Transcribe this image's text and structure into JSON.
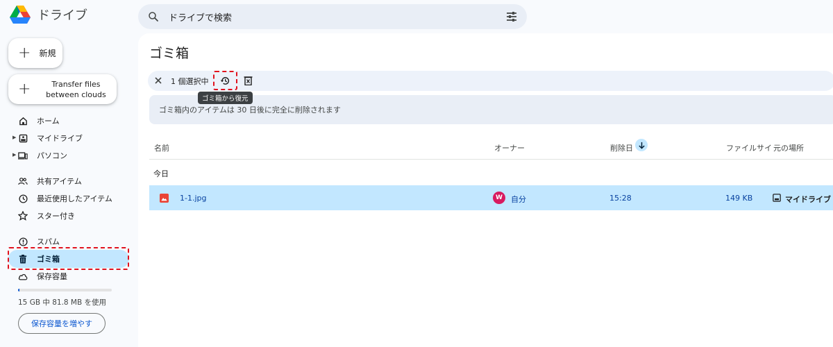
{
  "app": {
    "name": "ドライブ"
  },
  "search": {
    "placeholder": "ドライブで検索"
  },
  "sidebar": {
    "new_label": "新規",
    "transfer_label": "Transfer files between clouds",
    "items": [
      {
        "label": "ホーム",
        "icon": "home-icon"
      },
      {
        "label": "マイドライブ",
        "icon": "my-drive-icon",
        "expandable": true
      },
      {
        "label": "パソコン",
        "icon": "computer-icon",
        "expandable": true
      },
      {
        "label": "共有アイテム",
        "icon": "shared-icon"
      },
      {
        "label": "最近使用したアイテム",
        "icon": "clock-icon"
      },
      {
        "label": "スター付き",
        "icon": "star-icon"
      },
      {
        "label": "スパム",
        "icon": "spam-icon"
      },
      {
        "label": "ゴミ箱",
        "icon": "trash-icon",
        "active": true
      },
      {
        "label": "保存容量",
        "icon": "cloud-icon"
      }
    ],
    "storage": {
      "text": "15 GB 中 81.8 MB を使用",
      "used_fraction": 0.0053,
      "button_label": "保存容量を増やす"
    }
  },
  "main": {
    "title": "ゴミ箱",
    "toolbar": {
      "selected_text": "1 個選択中",
      "restore_tooltip": "ゴミ箱から復元"
    },
    "banner": "ゴミ箱内のアイテムは 30 日後に完全に削除されます",
    "columns": {
      "name": "名前",
      "owner": "オーナー",
      "deleted": "削除日",
      "size": "ファイルサイ",
      "location": "元の場所"
    },
    "group": "今日",
    "rows": [
      {
        "name": "1-1.jpg",
        "owner_initial": "W",
        "owner": "自分",
        "deleted": "15:28",
        "size": "149 KB",
        "location": "マイドライブ"
      }
    ]
  },
  "colors": {
    "accent": "#0b57d0",
    "selected": "#c2e7ff",
    "highlight": "#e0121e"
  }
}
